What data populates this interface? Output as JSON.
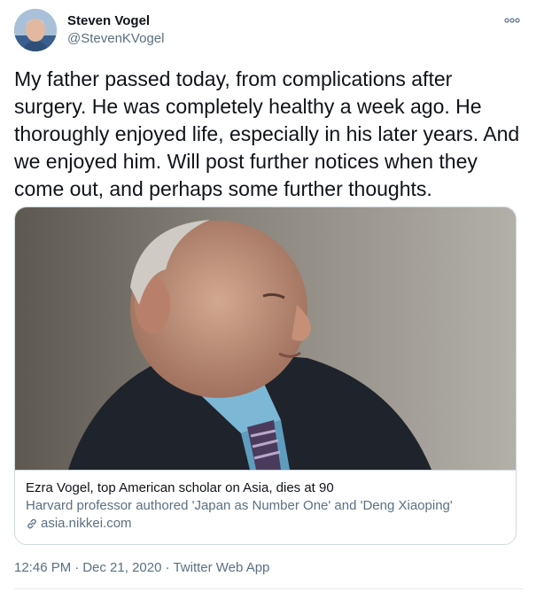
{
  "author": {
    "display_name": "Steven Vogel",
    "handle": "@StevenKVogel",
    "avatar_icon": "user-avatar"
  },
  "tweet": {
    "text": "My father passed today, from complications after\nsurgery. He was completely healthy a week ago. He\nthoroughly enjoyed life, especially in his later years. And\nwe enjoyed him. Will post further notices when they\ncome out, and perhaps some further thoughts."
  },
  "card": {
    "title": "Ezra Vogel, top American scholar on Asia, dies at 90",
    "description": "Harvard professor authored 'Japan as Number One' and 'Deng Xiaoping'",
    "domain": "asia.nikkei.com",
    "link_icon": "link-icon"
  },
  "meta": {
    "time": "12:46 PM",
    "separator": "·",
    "date": "Dec 21, 2020",
    "source": "Twitter Web App"
  },
  "colors": {
    "text_primary": "#0f1419",
    "text_secondary": "#5b7083",
    "border": "#cfd9de"
  }
}
